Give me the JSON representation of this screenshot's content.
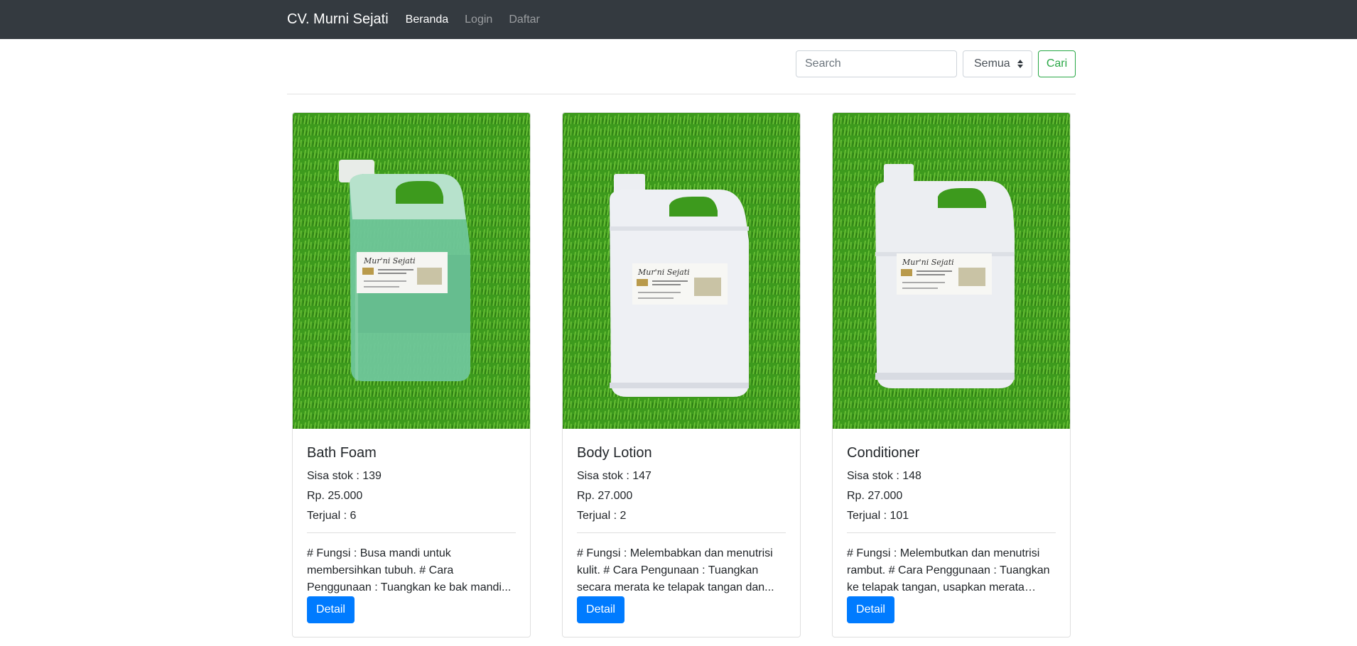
{
  "navbar": {
    "brand": "CV. Murni Sejati",
    "links": [
      {
        "label": "Beranda",
        "active": true
      },
      {
        "label": "Login",
        "active": false
      },
      {
        "label": "Daftar",
        "active": false
      }
    ]
  },
  "search": {
    "placeholder": "Search",
    "category_selected": "Semua",
    "button_label": "Cari"
  },
  "colors": {
    "navbar_bg": "#343a40",
    "primary": "#007bff",
    "success": "#28a745",
    "grass": "#3c9a1c"
  },
  "products": [
    {
      "name": "Bath Foam",
      "stock": "Sisa stok : 139",
      "price": "Rp. 25.000",
      "sold": "Terjual : 6",
      "description": "# Fungsi : Busa mandi untuk membersihkan tubuh. # Cara Penggunaan : Tuangkan ke bak mandi...",
      "button_label": "Detail",
      "liquid_color": "#6ec79a",
      "label_text": "Mur'ni Sejati"
    },
    {
      "name": "Body Lotion",
      "stock": "Sisa stok : 147",
      "price": "Rp. 27.000",
      "sold": "Terjual : 2",
      "description": "# Fungsi : Melembabkan dan menutrisi kulit. # Cara Pengunaan : Tuangkan secara merata ke telapak tangan dan...",
      "button_label": "Detail",
      "liquid_color": "#eef0f4",
      "label_text": "Mur'ni Sejati"
    },
    {
      "name": "Conditioner",
      "stock": "Sisa stok : 148",
      "price": "Rp. 27.000",
      "sold": "Terjual : 101",
      "description": "# Fungsi : Melembutkan dan menutrisi rambut. # Cara Penggunaan : Tuangkan ke telapak tangan, usapkan merata pad...",
      "button_label": "Detail",
      "liquid_color": "#eceef2",
      "label_text": "Mur'ni Sejati"
    }
  ]
}
